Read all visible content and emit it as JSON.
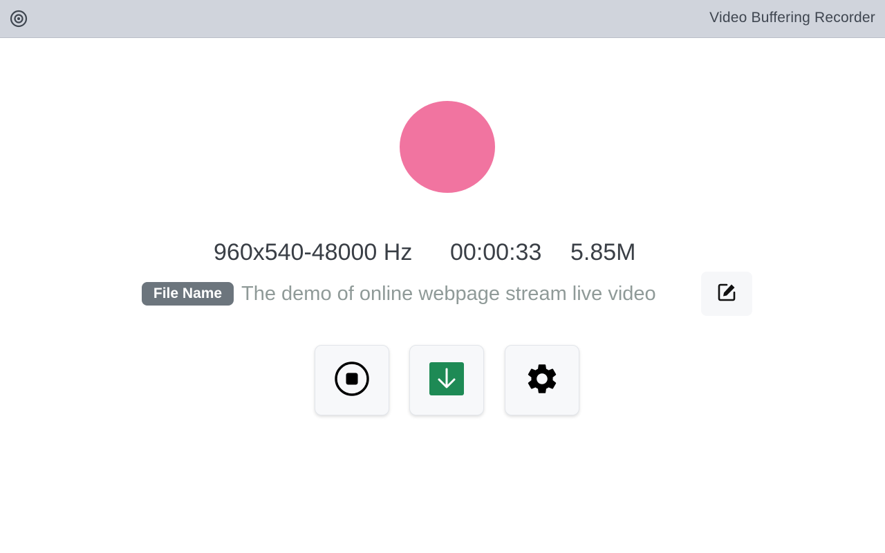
{
  "header": {
    "app_title": "Video Buffering Recorder",
    "logo_icon": "record-target-icon"
  },
  "indicator": {
    "state_color": "#f174a0"
  },
  "stats": {
    "resolution_rate": "960x540-48000 Hz",
    "duration": "00:00:33",
    "size": "5.85M"
  },
  "file": {
    "badge_label": "File Name",
    "name": "The demo of online webpage stream live video",
    "edit_icon": "edit-icon"
  },
  "actions": {
    "stop_icon": "stop-icon",
    "download_icon": "download-icon",
    "download_color": "#1e8a55",
    "settings_icon": "gear-icon"
  }
}
